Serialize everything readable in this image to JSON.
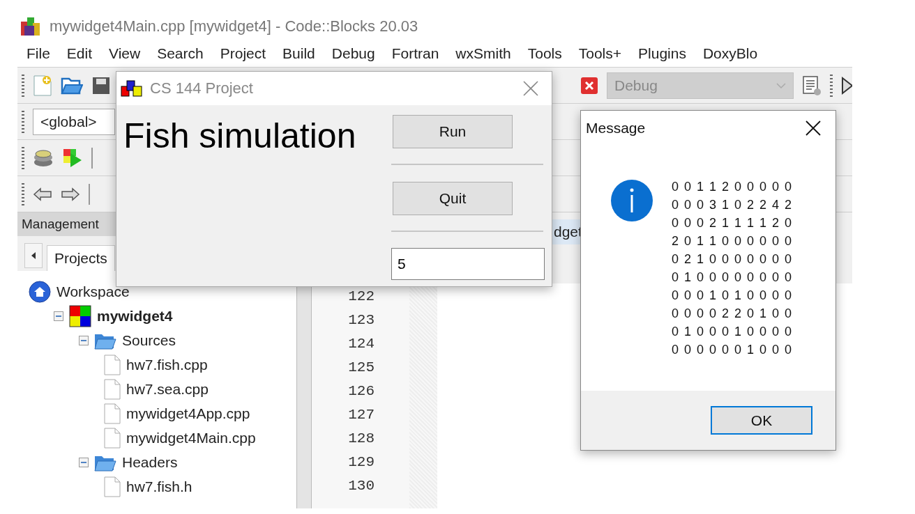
{
  "window": {
    "title": "mywidget4Main.cpp [mywidget4] - Code::Blocks 20.03"
  },
  "menu": [
    "File",
    "Edit",
    "View",
    "Search",
    "Project",
    "Build",
    "Debug",
    "Fortran",
    "wxSmith",
    "Tools",
    "Tools+",
    "Plugins",
    "DoxyBlo"
  ],
  "toolbar": {
    "build_target": "Debug",
    "scope": "<global>"
  },
  "management": {
    "title": "Management",
    "tabs": [
      {
        "label": "Projects",
        "selected": true
      }
    ],
    "tree": [
      {
        "label": "Workspace",
        "kind": "workspace",
        "children": [
          {
            "label": "mywidget4",
            "kind": "project",
            "expanded": true,
            "children": [
              {
                "label": "Sources",
                "kind": "folder",
                "expanded": true,
                "children": [
                  {
                    "label": "hw7.fish.cpp",
                    "kind": "file"
                  },
                  {
                    "label": "hw7.sea.cpp",
                    "kind": "file"
                  },
                  {
                    "label": "mywidget4App.cpp",
                    "kind": "file"
                  },
                  {
                    "label": "mywidget4Main.cpp",
                    "kind": "file"
                  }
                ]
              },
              {
                "label": "Headers",
                "kind": "folder",
                "expanded": true,
                "children": [
                  {
                    "label": "hw7.fish.h",
                    "kind": "file"
                  }
                ]
              }
            ]
          }
        ]
      }
    ]
  },
  "editor": {
    "tab_label": "dget",
    "line_numbers": [
      "122",
      "123",
      "124",
      "125",
      "126",
      "127",
      "128",
      "129",
      "130"
    ]
  },
  "app_dialog": {
    "title": "CS 144 Project",
    "heading": "Fish simulation",
    "buttons": [
      "Run",
      "Quit"
    ],
    "input_value": "5"
  },
  "message_box": {
    "title": "Message",
    "lines": [
      "0 0 1 1 2 0 0 0 0 0",
      "0 0 0 3 1 0 2 2 4 2",
      "0 0 0 2 1 1 1 1 2 0",
      "2 0 1 1 0 0 0 0 0 0",
      "0 2 1 0 0 0 0 0 0 0",
      "0 1 0 0 0 0 0 0 0 0",
      "0 0 0 1 0 1 0 0 0 0",
      "0 0 0 0 2 2 0 1 0 0",
      "0 1 0 0 0 1 0 0 0 0",
      "0 0 0 0 0 0 1 0 0 0"
    ],
    "button": "OK"
  }
}
